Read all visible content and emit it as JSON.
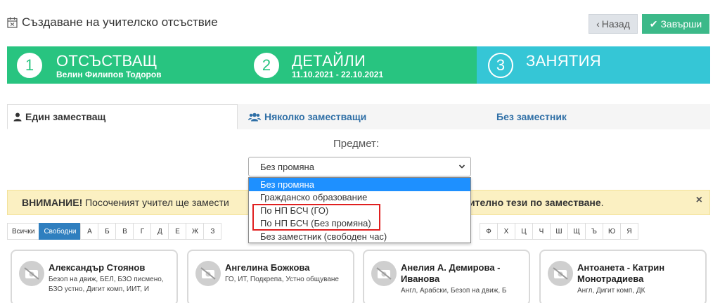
{
  "header": {
    "title": "Създаване на учителско отсъствие",
    "back_label": "Назад",
    "finish_label": "Завърши"
  },
  "steps": [
    {
      "num": "1",
      "title": "ОТСЪСТВАЩ",
      "sub": "Велин Филипов Тодоров"
    },
    {
      "num": "2",
      "title": "ДЕТАЙЛИ",
      "sub": "11.10.2021 - 22.10.2021"
    },
    {
      "num": "3",
      "title": "ЗАНЯТИЯ",
      "sub": ""
    }
  ],
  "tabs": {
    "single": "Един заместващ",
    "multi": "Няколко заместващи",
    "none": "Без заместник"
  },
  "subject": {
    "label": "Предмет:",
    "selected": "Без промяна",
    "options": [
      "Без промяна",
      "Гражданско образование",
      "По НП БСЧ (ГО)",
      "По НП БСЧ (Без промяна)",
      "Без заместник (свободен час)"
    ]
  },
  "alert": {
    "strong_left": "ВНИМАНИЕ!",
    "text_left": " Посоченият учител ще замести",
    "text_right": "ително тези по заместване",
    "dot": "."
  },
  "letters_left": [
    "Всички",
    "Свободни",
    "А",
    "Б",
    "В",
    "Г",
    "Д",
    "Е",
    "Ж",
    "З"
  ],
  "letters_right": [
    "Ф",
    "Х",
    "Ц",
    "Ч",
    "Ш",
    "Щ",
    "Ъ",
    "Ю",
    "Я"
  ],
  "cards": [
    {
      "name": "Александър Стоянов",
      "desc": "Безоп на движ, БЕЛ, БЗО писмено, БЗО устно, Дигит комп, ИИТ, И"
    },
    {
      "name": "Ангелина Божкова",
      "desc": "ГО, ИТ, Подкрепа, Устно общуване"
    },
    {
      "name": "Анелия А. Демирова - Иванова",
      "desc": "Англ, Арабски, Безоп на движ, Б"
    },
    {
      "name": "Антоанета - Катрин Монотрадиева",
      "desc": "Англ, Дигит комп, ДК"
    }
  ],
  "colors": {
    "step_green": "#28c480",
    "step_teal": "#35c6d6",
    "finish_green": "#3cb989",
    "highlight_red": "#e02020"
  }
}
